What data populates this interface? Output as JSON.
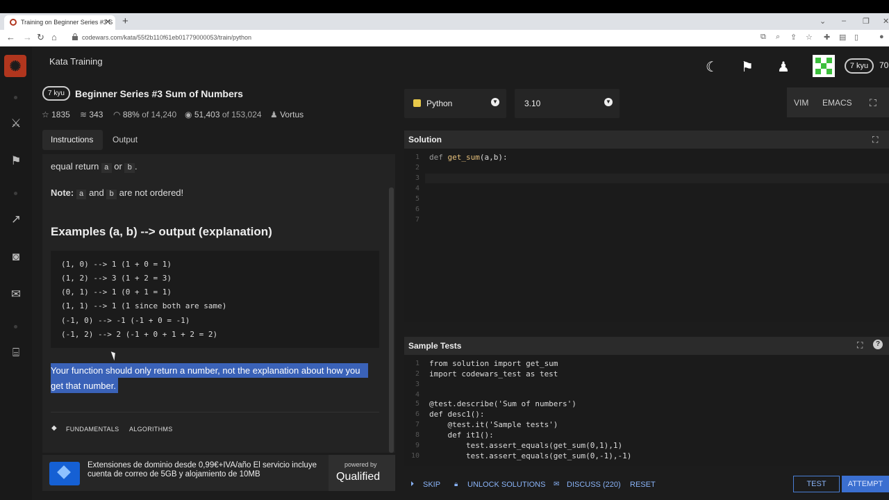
{
  "browser": {
    "tab_title": "Training on Beginner Series #3 S",
    "url": "codewars.com/kata/55f2b110f61eb01779000053/train/python"
  },
  "header": {
    "section": "Kata Training",
    "rank": "7 kyu",
    "honor": "70"
  },
  "kata": {
    "rank": "7 kyu",
    "title": "Beginner Series #3 Sum of Numbers",
    "stars": "1835",
    "collections": "343",
    "satisfaction": "88%",
    "satisfaction_of": "of 14,240",
    "completed": "51,403",
    "completed_of": "of 153,024",
    "author": "Vortus"
  },
  "tabs": {
    "instructions": "Instructions",
    "output": "Output"
  },
  "instructions": {
    "line1_a": "equal return",
    "code_a": "a",
    "or": "or",
    "code_b": "b",
    "period": ".",
    "note_label": "Note:",
    "note_a": "a",
    "note_and": "and",
    "note_b": "b",
    "note_rest": "are not ordered!",
    "examples_heading": "Examples (a, b) --> output (explanation)",
    "code_lines": [
      "(1, 0) --> 1 (1 + 0 = 1)",
      "(1, 2) --> 3 (1 + 2 = 3)",
      "(0, 1) --> 1 (0 + 1 = 1)",
      "(1, 1) --> 1 (1 since both are same)",
      "(-1, 0) --> -1 (-1 + 0 = -1)",
      "(-1, 2) --> 2 (-1 + 0 + 1 + 2 = 2)"
    ],
    "highlight_line1": "Your function should only return a number, not the explanation about how you",
    "highlight_line2": "get that number.",
    "tags": [
      "FUNDAMENTALS",
      "ALGORITHMS"
    ]
  },
  "ad": {
    "text": "Extensiones de dominio desde 0,99€+IVA/año El servicio incluye cuenta de correo de 5GB y alojamiento de 10MB",
    "powered_by": "powered by",
    "brand": "Qualified"
  },
  "editor_controls": {
    "language": "Python",
    "version": "3.10",
    "vim": "VIM",
    "emacs": "EMACS"
  },
  "solution": {
    "title": "Solution",
    "line_numbers": [
      "1",
      "2",
      "3",
      "4",
      "5",
      "6",
      "7"
    ],
    "code_def": "def",
    "code_fn": "get_sum",
    "code_args": "(a,b):"
  },
  "sample_tests": {
    "title": "Sample Tests",
    "line_numbers": [
      "1",
      "2",
      "3",
      "4",
      "5",
      "6",
      "7",
      "8",
      "9",
      "10"
    ],
    "lines": [
      "from solution import get_sum",
      "import codewars_test as test",
      "",
      "",
      "@test.describe('Sum of numbers')",
      "def desc1():",
      "    @test.it('Sample tests')",
      "    def it1():",
      "        test.assert_equals(get_sum(0,1),1)",
      "        test.assert_equals(get_sum(0,-1),-1)"
    ]
  },
  "actions": {
    "skip": "SKIP",
    "unlock": "UNLOCK SOLUTIONS",
    "discuss": "DISCUSS (220)",
    "reset": "RESET",
    "test": "TEST",
    "attempt": "ATTEMPT"
  },
  "colors": {
    "brand": "#b1361e",
    "highlight": "#3a62b8",
    "accent": "#3b6fd0"
  }
}
